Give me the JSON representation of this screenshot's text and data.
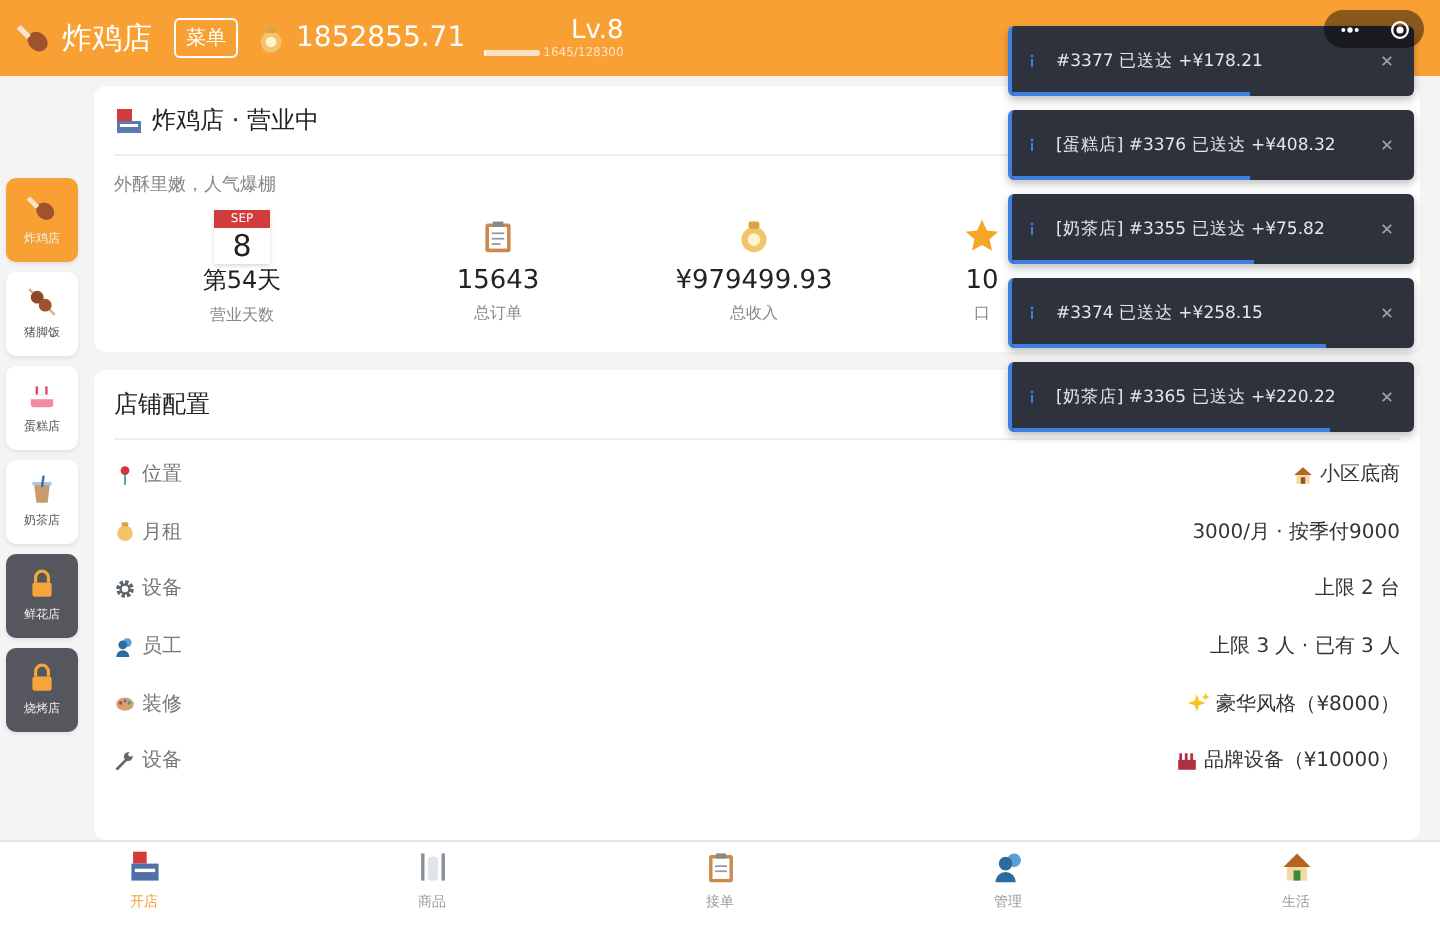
{
  "header": {
    "shop_name": "炸鸡店",
    "menu_badge": "菜单",
    "money": "1852855.71",
    "level_label": "Lv.8",
    "exp": "1645/128300",
    "level": 0.013
  },
  "sidebar": {
    "items": [
      {
        "label": "炸鸡店",
        "selected": true,
        "locked": false
      },
      {
        "label": "猪脚饭",
        "selected": false,
        "locked": false
      },
      {
        "label": "蛋糕店",
        "selected": false,
        "locked": false
      },
      {
        "label": "奶茶店",
        "selected": false,
        "locked": false
      },
      {
        "label": "鲜花店",
        "selected": false,
        "locked": true
      },
      {
        "label": "烧烤店",
        "selected": false,
        "locked": true
      }
    ]
  },
  "status_card": {
    "title": "炸鸡店 · 营业中",
    "slogan": "外酥里嫩，人气爆棚",
    "calendar_month": "SEP",
    "calendar_day": "8",
    "stats": [
      {
        "value": "第54天",
        "label": "营业天数"
      },
      {
        "value": "15643",
        "label": "总订单"
      },
      {
        "value": "¥979499.93",
        "label": "总收入"
      },
      {
        "value": "10",
        "label": "口"
      }
    ]
  },
  "config_card": {
    "title": "店铺配置",
    "rows": [
      {
        "label": "位置",
        "value": "小区底商"
      },
      {
        "label": "月租",
        "value": "3000/月 · 按季付9000"
      },
      {
        "label": "设备",
        "value": "上限 2 台"
      },
      {
        "label": "员工",
        "value": "上限 3 人 · 已有 3 人"
      },
      {
        "label": "装修",
        "value": "豪华风格（¥8000）"
      },
      {
        "label": "设备",
        "value": "品牌设备（¥10000）"
      }
    ]
  },
  "toasts": [
    {
      "text": "#3377 已送达 +¥178.21",
      "level": 0.59
    },
    {
      "text": "[蛋糕店] #3376 已送达 +¥408.32",
      "level": 0.59
    },
    {
      "text": "[奶茶店] #3355 已送达 +¥75.82",
      "level": 0.6
    },
    {
      "text": "#3374 已送达 +¥258.15",
      "level": 0.78
    },
    {
      "text": "[奶茶店] #3365 已送达 +¥220.22",
      "level": 0.79
    }
  ],
  "tab_bar": [
    {
      "label": "开店",
      "selected": true
    },
    {
      "label": "商品",
      "selected": false
    },
    {
      "label": "接单",
      "selected": false
    },
    {
      "label": "管理",
      "selected": false
    },
    {
      "label": "生活",
      "selected": false
    }
  ]
}
